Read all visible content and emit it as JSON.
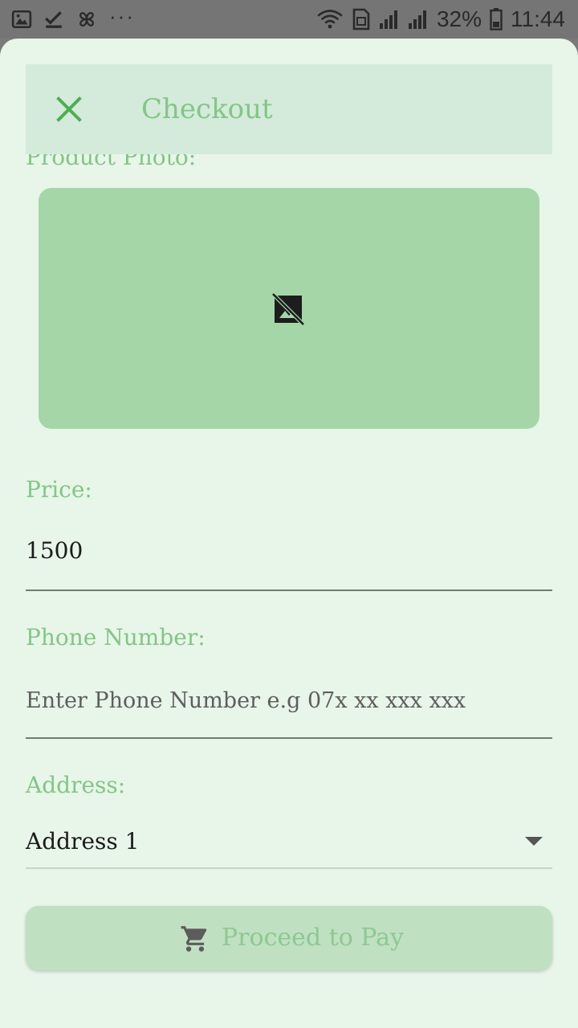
{
  "status_bar": {
    "battery": "32%",
    "time": "11:44",
    "overflow": "···"
  },
  "app_bar": {
    "title": "Checkout"
  },
  "photo": {
    "label": "Product Photo:"
  },
  "price": {
    "label": "Price:",
    "value": "1500"
  },
  "phone": {
    "label": "Phone Number:",
    "value": "",
    "placeholder": "Enter Phone Number e.g 07x xx xxx xxx"
  },
  "address": {
    "label": "Address:",
    "selected": "Address 1"
  },
  "pay_button": {
    "label": "Proceed to Pay"
  },
  "colors": {
    "accent": "#81c784",
    "close_icon": "#4caf50",
    "photo_bg": "#a5d6a7",
    "sheet_bg": "#e8f5e9",
    "button_bg": "#c0e0c2"
  },
  "icons": {
    "close": "close-icon",
    "no_image": "hide-image-icon",
    "cart": "shopping-cart-icon",
    "dropdown": "arrow-drop-down-icon"
  }
}
